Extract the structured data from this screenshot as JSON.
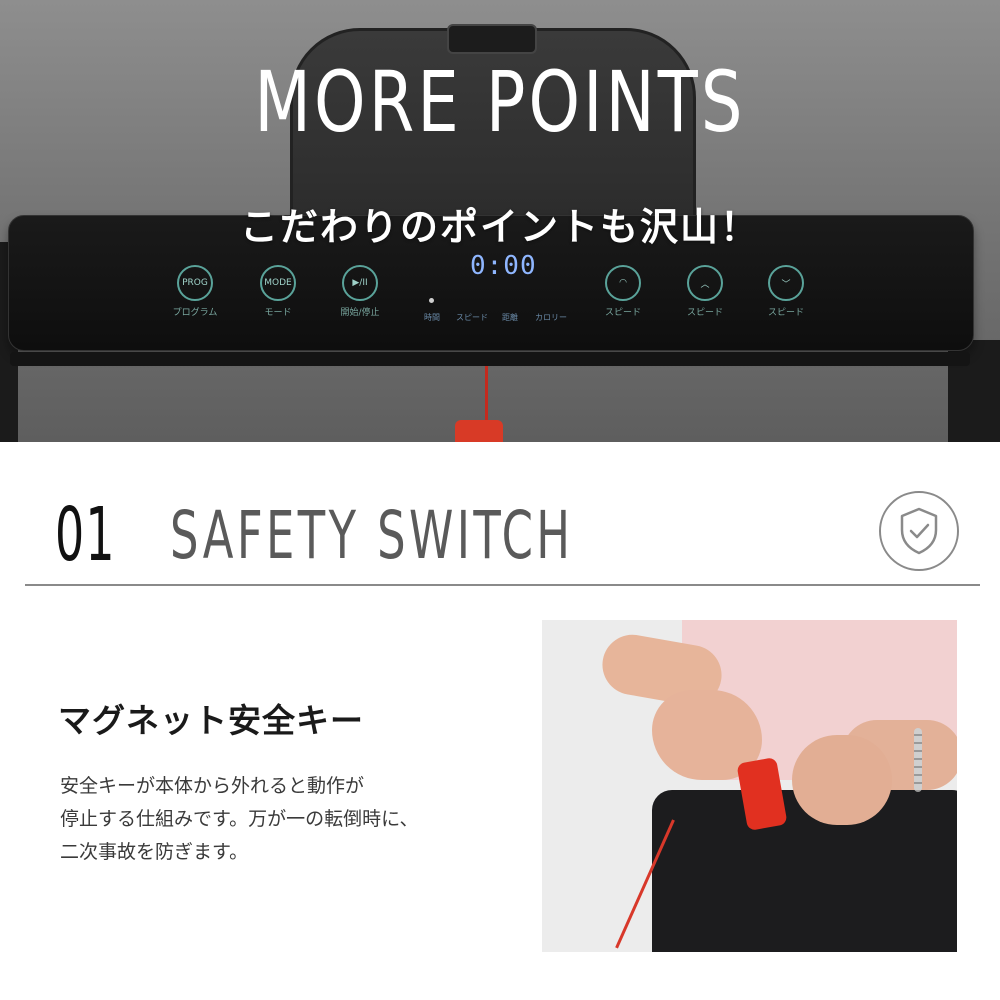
{
  "hero": {
    "title": "MORE POINTS",
    "subtitle": "こだわりのポイントも沢山！",
    "console": {
      "display": "0:00",
      "buttons": [
        {
          "icon": "prog-icon",
          "symbol": "PROG",
          "label": "プログラム"
        },
        {
          "icon": "mode-icon",
          "symbol": "MODE",
          "label": "モード"
        },
        {
          "icon": "start-stop-icon",
          "symbol": "▶/II",
          "label": "開始/停止"
        },
        {
          "icon": "speed-preset-icon",
          "symbol": "◠",
          "label": "スピード"
        },
        {
          "icon": "speed-up-icon",
          "symbol": "︿",
          "label": "スピード"
        },
        {
          "icon": "speed-down-icon",
          "symbol": "﹀",
          "label": "スピード"
        }
      ],
      "indicators": [
        "時間",
        "スピード",
        "距離",
        "カロリー"
      ]
    }
  },
  "section": {
    "number": "01",
    "title": "SAFETY SWITCH",
    "icon": "shield-check-icon"
  },
  "feature": {
    "title": "マグネット安全キー",
    "description_lines": [
      "安全キーが本体から外れると動作が",
      "停止する仕組みです。万が一の転倒時に、",
      "二次事故を防ぎます。"
    ]
  },
  "colors": {
    "accent_line": "#8a8a8a",
    "key_red": "#e13020",
    "console_teal": "#5aa39a",
    "display_blue": "#8fb6ff"
  }
}
